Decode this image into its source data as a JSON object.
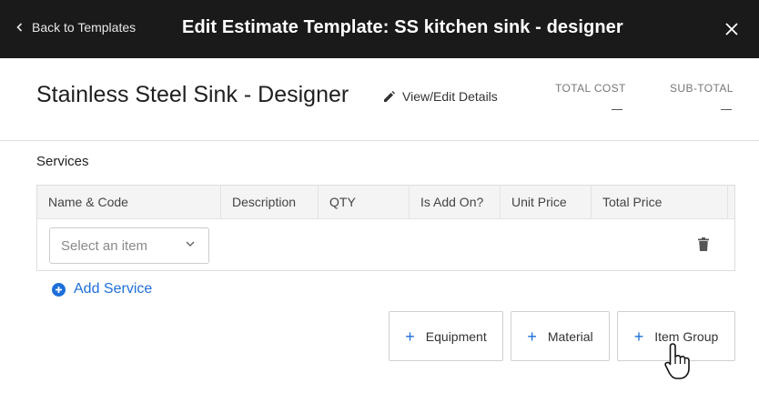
{
  "topbar": {
    "back_label": "Back to Templates",
    "title": "Edit Estimate Template: SS kitchen sink - designer"
  },
  "header": {
    "page_title": "Stainless Steel Sink - Designer",
    "view_edit_label": "View/Edit Details",
    "total_cost_label": "TOTAL COST",
    "sub_total_label": "SUB-TOTAL"
  },
  "services": {
    "section_label": "Services",
    "columns": [
      "Name & Code",
      "Description",
      "QTY",
      "Is Add On?",
      "Unit Price",
      "Total Price"
    ],
    "row": {
      "select_placeholder": "Select an item"
    },
    "add_service_label": "Add Service"
  },
  "add_buttons": {
    "equipment_label": "Equipment",
    "material_label": "Material",
    "item_group_label": "Item Group"
  },
  "colors": {
    "topbar_bg": "#1a1a1a",
    "accent_blue": "#1e6fd9"
  }
}
